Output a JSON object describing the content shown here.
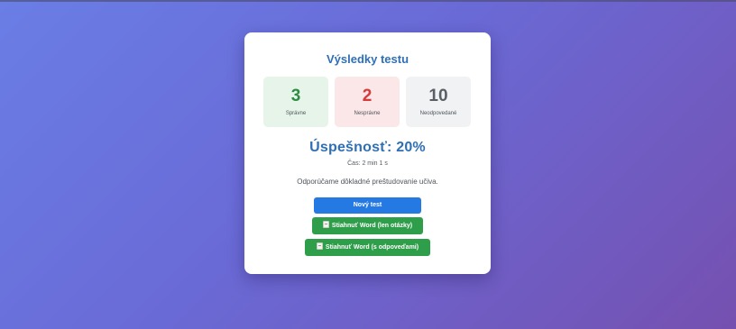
{
  "results": {
    "title": "Výsledky testu",
    "stats": [
      {
        "value": "3",
        "label": "Správne"
      },
      {
        "value": "2",
        "label": "Nesprávne"
      },
      {
        "value": "10",
        "label": "Neodpovedané"
      }
    ],
    "success": "Úspešnosť: 20%",
    "time": "Čas: 2 min 1 s",
    "advice": "Odporúčame dôkladné preštudovanie učiva."
  },
  "buttons": {
    "new_test": "Nový test",
    "download_questions": "Stiahnuť Word (len otázky)",
    "download_answers": "Stiahnuť Word (s odpoveďami)"
  },
  "icons": {
    "document": "document-icon"
  },
  "colors": {
    "title": "#2f6fb6",
    "correct": "#2e8b44",
    "wrong": "#d63a3a",
    "unanswered": "#5a5f66",
    "primary_button": "#2579e3",
    "download_button": "#2f9e4a"
  }
}
